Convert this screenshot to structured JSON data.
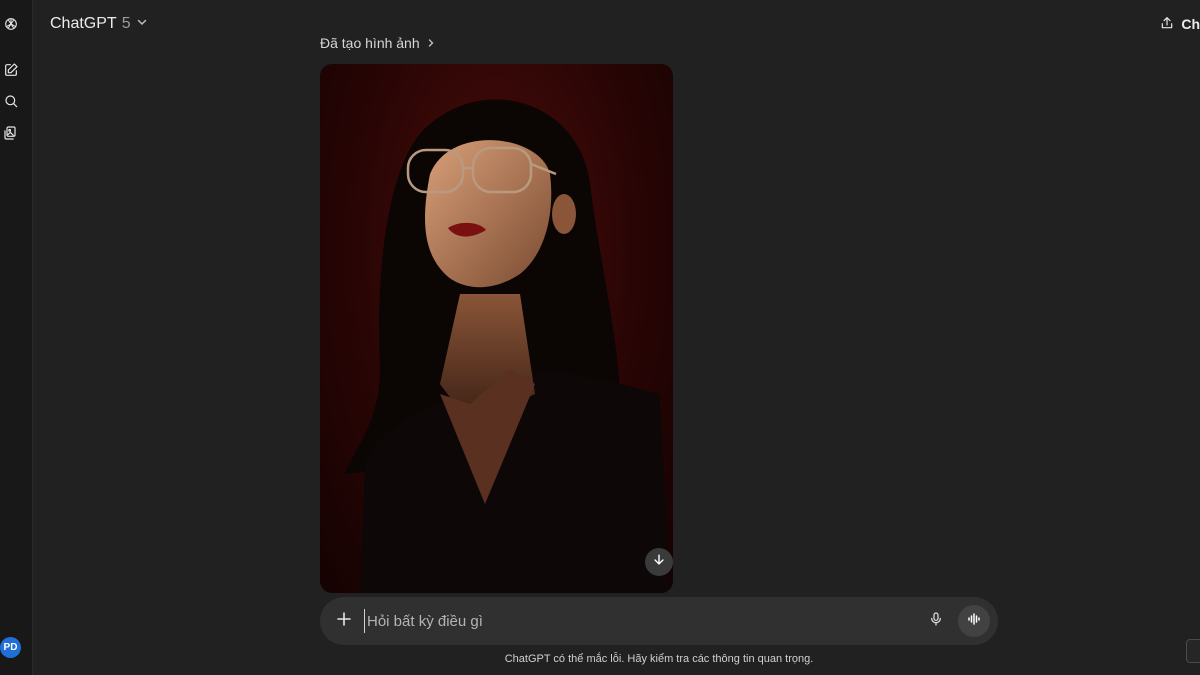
{
  "header": {
    "model_name": "ChatGPT",
    "model_version": "5",
    "share_label": "Ch"
  },
  "sidebar": {
    "user_initials": "PD",
    "icons": [
      "openai-logo-icon",
      "new-chat-icon",
      "search-icon",
      "library-icon"
    ]
  },
  "message": {
    "generation_label": "Đã tạo hình ảnh",
    "image_alt": "Generated portrait image"
  },
  "composer": {
    "placeholder": "Hỏi bất kỳ điều gì"
  },
  "footer": {
    "disclaimer": "ChatGPT có thể mắc lỗi. Hãy kiểm tra các thông tin quan trọng."
  },
  "colors": {
    "background": "#212121",
    "rail": "#181818",
    "composer": "#303030",
    "avatar": "#1f6fd6"
  }
}
